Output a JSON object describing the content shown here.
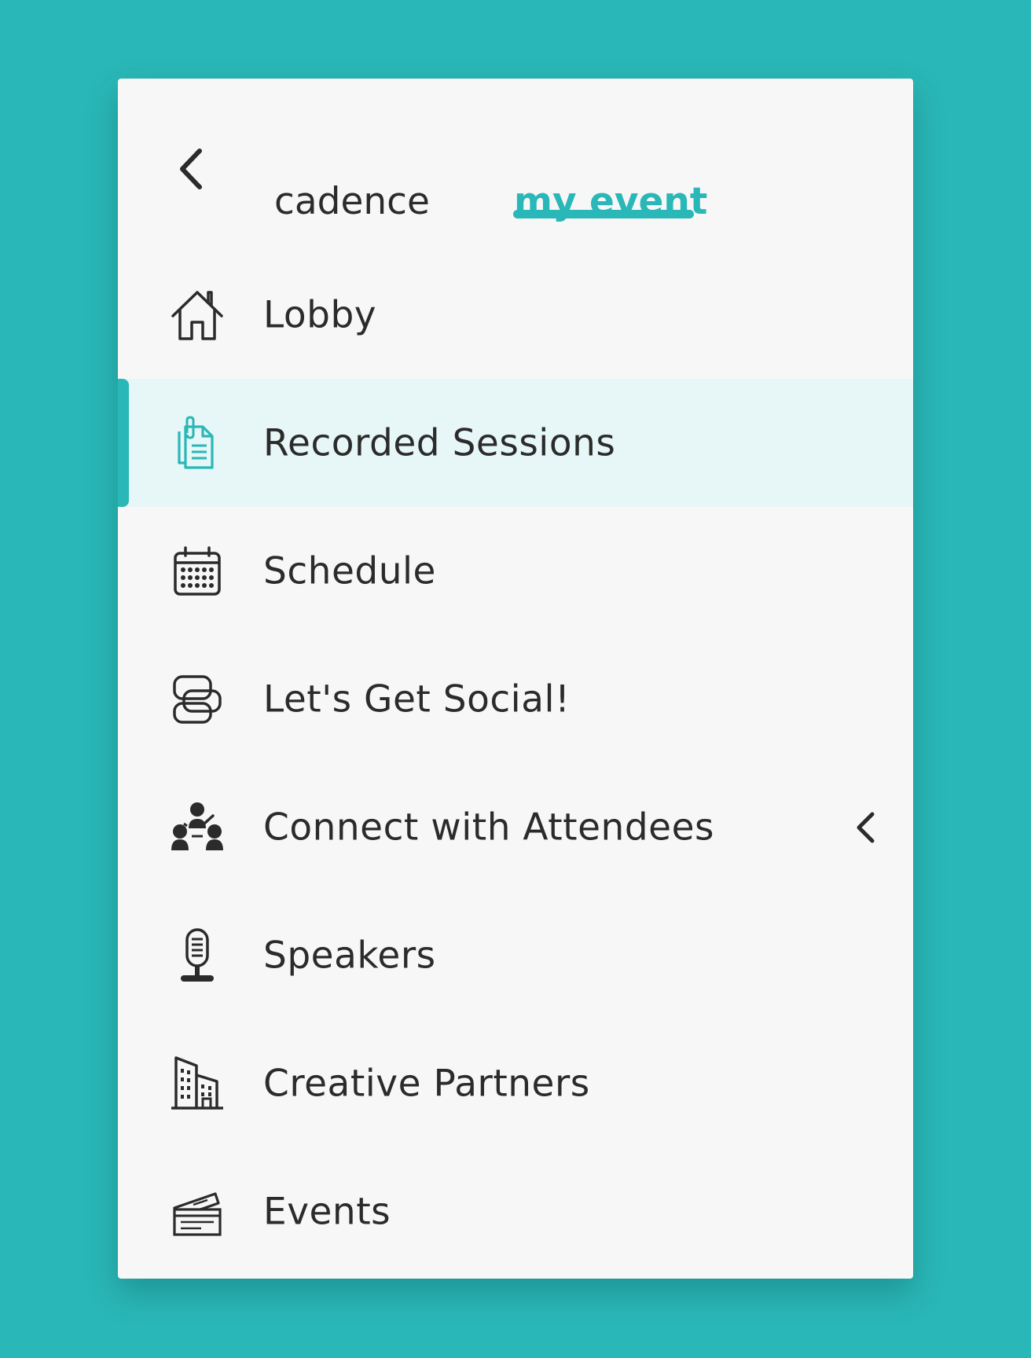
{
  "colors": {
    "background": "#2ab7b7",
    "accent": "#2ab7b7",
    "panel": "#f7f7f7",
    "active_row": "#e7f6f6",
    "text": "#2b2b2b"
  },
  "header": {
    "back_icon": "chevron-left-icon",
    "tabs": [
      {
        "label": "cadence",
        "selected": false
      },
      {
        "label": "my event",
        "selected": true
      }
    ]
  },
  "menu": {
    "items": [
      {
        "label": "Lobby",
        "icon": "house-icon",
        "active": false
      },
      {
        "label": "Recorded Sessions",
        "icon": "documents-icon",
        "active": true
      },
      {
        "label": "Schedule",
        "icon": "calendar-icon",
        "active": false
      },
      {
        "label": "Let's Get Social!",
        "icon": "chat-bubbles-icon",
        "active": false
      },
      {
        "label": "Connect with Attendees",
        "icon": "people-network-icon",
        "active": false,
        "expandable": true,
        "expand_icon": "chevron-left-icon"
      },
      {
        "label": "Speakers",
        "icon": "microphone-icon",
        "active": false
      },
      {
        "label": "Creative Partners",
        "icon": "buildings-icon",
        "active": false
      },
      {
        "label": "Events",
        "icon": "tickets-icon",
        "active": false
      }
    ]
  }
}
